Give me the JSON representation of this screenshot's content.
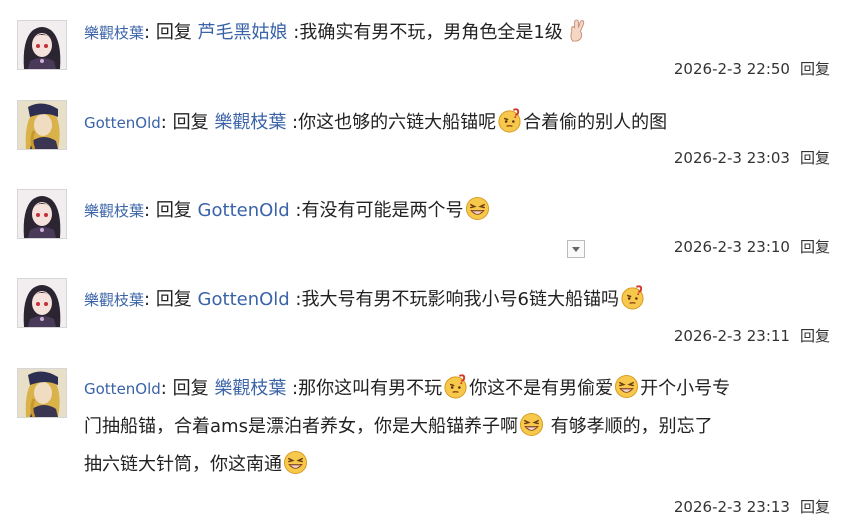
{
  "comments": [
    {
      "author": "樂觀枝葉",
      "colon": ": ",
      "reply_word": "回复 ",
      "target": "芦毛黑姑娘",
      "text_1": " :我确实有男不玩，男角色全是1级",
      "timestamp": "2026-2-3 22:50",
      "reply_label": "回复"
    },
    {
      "author": "GottenOld",
      "colon": ": ",
      "reply_word": "回复 ",
      "target": "樂觀枝葉",
      "text_1": " :你这也够的六链大船锚呢",
      "text_2": "合着偷的别人的图",
      "timestamp": "2026-2-3 23:03",
      "reply_label": "回复"
    },
    {
      "author": "樂觀枝葉",
      "colon": ": ",
      "reply_word": "回复 ",
      "target": "GottenOld",
      "text_1": " :有没有可能是两个号",
      "timestamp": "2026-2-3 23:10",
      "reply_label": "回复"
    },
    {
      "author": "樂觀枝葉",
      "colon": ": ",
      "reply_word": "回复 ",
      "target": "GottenOld",
      "text_1": " :我大号有男不玩影响我小号6链大船锚吗",
      "timestamp": "2026-2-3 23:11",
      "reply_label": "回复"
    },
    {
      "author": "GottenOld",
      "colon": ": ",
      "reply_word": "回复 ",
      "target": "樂觀枝葉",
      "text_1": " :那你这叫有男不玩",
      "text_2": "你这不是有男偷爱",
      "text_3": "开个小号专",
      "line_2": "门抽船锚，合着ams是漂泊者养女，你是大船锚养子啊",
      "line_2b": " 有够孝顺的，别忘了",
      "line_3": "抽六链大针筒，你这南通",
      "timestamp": "2026-2-3 23:13",
      "reply_label": "回复"
    }
  ],
  "icons": {
    "avatar_a": "anime-girl-avatar",
    "avatar_b": "blonde-character-avatar",
    "emoji_confused": "confused-question-emoji",
    "emoji_grin": "squint-grin-emoji",
    "emoji_peace": "peace-hand-emoji",
    "dropdown": "chevron-down-icon"
  },
  "colors": {
    "username": "#3a63a8",
    "text": "#222222",
    "meta": "#333333"
  }
}
